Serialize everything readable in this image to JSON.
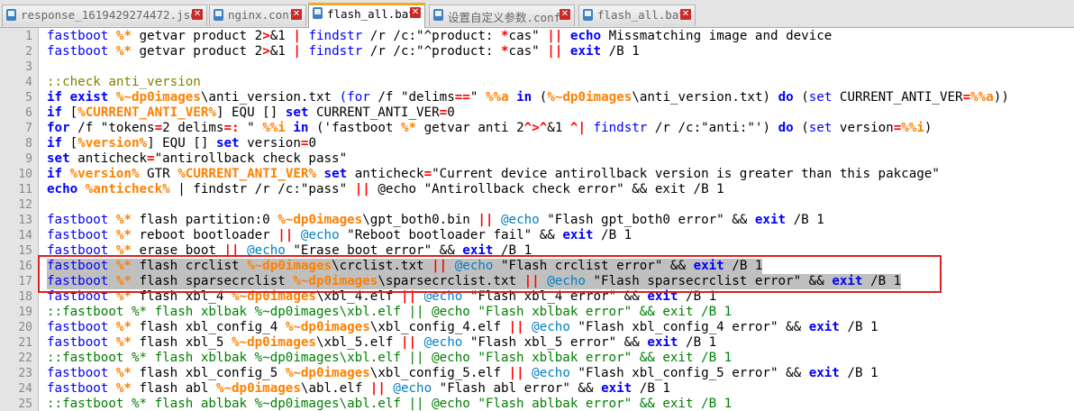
{
  "tabs": [
    {
      "label": "response_1619429274472.json",
      "active": false
    },
    {
      "label": "nginx.conf",
      "active": false
    },
    {
      "label": "flash_all.bat",
      "active": true
    },
    {
      "label": "设置自定义参数.conf",
      "active": false
    },
    {
      "label": "flash_all.bat",
      "active": false
    }
  ],
  "colors": {
    "keyword": "#0000ff",
    "variable": "#ff8000",
    "operator": "#ff0000",
    "comment": "#008000",
    "label": "#808000",
    "selection": "#c0c0c0",
    "highlight_box": "#e02020",
    "active_tab_accent": "#f5a623"
  },
  "editor": {
    "highlight_box_lines": [
      16,
      17
    ],
    "selected_lines": [
      16,
      17
    ],
    "lines": [
      {
        "n": "1",
        "tokens": [
          [
            "fastboot ",
            "ex"
          ],
          [
            "%*",
            "var"
          ],
          [
            " getvar product 2",
            "tx"
          ],
          [
            ">",
            "op"
          ],
          [
            "&1 ",
            "tx"
          ],
          [
            "|",
            "op"
          ],
          [
            " ",
            "tx"
          ],
          [
            "findstr",
            "ex"
          ],
          [
            " /r /c:\"^product: ",
            "tx"
          ],
          [
            "*",
            "op"
          ],
          [
            "cas\" ",
            "tx"
          ],
          [
            "||",
            "op"
          ],
          [
            " ",
            "tx"
          ],
          [
            "echo",
            "kw"
          ],
          [
            " Missmatching image and device",
            "tx"
          ]
        ]
      },
      {
        "n": "2",
        "tokens": [
          [
            "fastboot ",
            "ex"
          ],
          [
            "%*",
            "var"
          ],
          [
            " getvar product 2",
            "tx"
          ],
          [
            ">",
            "op"
          ],
          [
            "&1 ",
            "tx"
          ],
          [
            "|",
            "op"
          ],
          [
            " ",
            "tx"
          ],
          [
            "findstr",
            "ex"
          ],
          [
            " /r /c:\"^product: ",
            "tx"
          ],
          [
            "*",
            "op"
          ],
          [
            "cas\" ",
            "tx"
          ],
          [
            "||",
            "op"
          ],
          [
            " ",
            "tx"
          ],
          [
            "exit",
            "kw"
          ],
          [
            " /B 1",
            "tx"
          ]
        ]
      },
      {
        "n": "3",
        "tokens": []
      },
      {
        "n": "4",
        "tokens": [
          [
            "::check anti_version",
            "lb"
          ]
        ]
      },
      {
        "n": "5",
        "tokens": [
          [
            "if",
            "kw"
          ],
          [
            " ",
            "tx"
          ],
          [
            "exist",
            "kw"
          ],
          [
            " ",
            "tx"
          ],
          [
            "%~dp0images",
            "var"
          ],
          [
            "\\anti_version.txt ",
            "tx"
          ],
          [
            "(",
            "ex"
          ],
          [
            "for",
            "ex"
          ],
          [
            " /f \"delims",
            "tx"
          ],
          [
            "==",
            "op"
          ],
          [
            "\" ",
            "tx"
          ],
          [
            "%%a",
            "var"
          ],
          [
            " ",
            "tx"
          ],
          [
            "in",
            "kw"
          ],
          [
            " (",
            "tx"
          ],
          [
            "%~dp0images",
            "var"
          ],
          [
            "\\anti_version.txt) ",
            "tx"
          ],
          [
            "do",
            "kw"
          ],
          [
            " (",
            "tx"
          ],
          [
            "set",
            "ex"
          ],
          [
            " CURRENT_ANTI_VER",
            "tx"
          ],
          [
            "=",
            "op"
          ],
          [
            "%%a",
            "var"
          ],
          [
            "))",
            "tx"
          ]
        ]
      },
      {
        "n": "6",
        "tokens": [
          [
            "if",
            "kw"
          ],
          [
            " [",
            "tx"
          ],
          [
            "%CURRENT_ANTI_VER%",
            "var"
          ],
          [
            "] EQU [] ",
            "tx"
          ],
          [
            "set",
            "kw"
          ],
          [
            " CURRENT_ANTI_VER",
            "tx"
          ],
          [
            "=",
            "op"
          ],
          [
            "0",
            "tx"
          ]
        ]
      },
      {
        "n": "7",
        "tokens": [
          [
            "for",
            "kw"
          ],
          [
            " /f \"tokens",
            "tx"
          ],
          [
            "=",
            "op"
          ],
          [
            "2 delims",
            "tx"
          ],
          [
            "=: ",
            "op"
          ],
          [
            "\" ",
            "tx"
          ],
          [
            "%%i",
            "var"
          ],
          [
            " ",
            "tx"
          ],
          [
            "in",
            "kw"
          ],
          [
            " ('fastboot ",
            "tx"
          ],
          [
            "%*",
            "var"
          ],
          [
            " getvar anti 2",
            "tx"
          ],
          [
            "^>^",
            "op"
          ],
          [
            "&1 ",
            "tx"
          ],
          [
            "^|",
            "op"
          ],
          [
            " ",
            "tx"
          ],
          [
            "findstr",
            "ex"
          ],
          [
            " /r /c:\"anti:\"') ",
            "tx"
          ],
          [
            "do",
            "kw"
          ],
          [
            " (",
            "tx"
          ],
          [
            "set",
            "ex"
          ],
          [
            " version",
            "tx"
          ],
          [
            "=",
            "op"
          ],
          [
            "%%i",
            "var"
          ],
          [
            ")",
            "tx"
          ]
        ]
      },
      {
        "n": "8",
        "tokens": [
          [
            "if",
            "kw"
          ],
          [
            " [",
            "tx"
          ],
          [
            "%version%",
            "var"
          ],
          [
            "] EQU [] ",
            "tx"
          ],
          [
            "set",
            "kw"
          ],
          [
            " version",
            "tx"
          ],
          [
            "=",
            "op"
          ],
          [
            "0",
            "tx"
          ]
        ]
      },
      {
        "n": "9",
        "tokens": [
          [
            "set",
            "kw"
          ],
          [
            " anticheck",
            "tx"
          ],
          [
            "=",
            "op"
          ],
          [
            "\"antirollback check pass\"",
            "tx"
          ]
        ]
      },
      {
        "n": "10",
        "tokens": [
          [
            "if",
            "kw"
          ],
          [
            " ",
            "tx"
          ],
          [
            "%version%",
            "var"
          ],
          [
            " GTR ",
            "tx"
          ],
          [
            "%CURRENT_ANTI_VER%",
            "var"
          ],
          [
            " ",
            "tx"
          ],
          [
            "set",
            "kw"
          ],
          [
            " anticheck",
            "tx"
          ],
          [
            "=",
            "op"
          ],
          [
            "\"Current device antirollback version is greater than this pakcage\"",
            "tx"
          ]
        ]
      },
      {
        "n": "11",
        "tokens": [
          [
            "echo",
            "kw"
          ],
          [
            " ",
            "tx"
          ],
          [
            "%anticheck%",
            "var"
          ],
          [
            " | findstr /r /c:\"pass\" ",
            "tx"
          ],
          [
            "||",
            "op"
          ],
          [
            " @echo \"Antirollback check error\" && exit /B 1",
            "tx"
          ]
        ]
      },
      {
        "n": "12",
        "tokens": []
      },
      {
        "n": "13",
        "tokens": [
          [
            "fastboot ",
            "ex"
          ],
          [
            "%*",
            "var"
          ],
          [
            " flash partition:0 ",
            "tx"
          ],
          [
            "%~dp0images",
            "var"
          ],
          [
            "\\gpt_both0.bin ",
            "tx"
          ],
          [
            "||",
            "op"
          ],
          [
            " ",
            "tx"
          ],
          [
            "@echo",
            "at"
          ],
          [
            " \"Flash gpt_both0 error\" && ",
            "tx"
          ],
          [
            "exit",
            "kw"
          ],
          [
            " /B 1",
            "tx"
          ]
        ]
      },
      {
        "n": "14",
        "tokens": [
          [
            "fastboot ",
            "ex"
          ],
          [
            "%*",
            "var"
          ],
          [
            " reboot bootloader ",
            "tx"
          ],
          [
            "||",
            "op"
          ],
          [
            " ",
            "tx"
          ],
          [
            "@echo",
            "at"
          ],
          [
            " \"Reboot bootloader fail\" && ",
            "tx"
          ],
          [
            "exit",
            "kw"
          ],
          [
            " /B 1",
            "tx"
          ]
        ]
      },
      {
        "n": "15",
        "tokens": [
          [
            "fastboot ",
            "ex"
          ],
          [
            "%*",
            "var"
          ],
          [
            " erase boot ",
            "tx"
          ],
          [
            "||",
            "op"
          ],
          [
            " ",
            "tx"
          ],
          [
            "@echo",
            "at"
          ],
          [
            " \"Erase boot error\" && ",
            "tx"
          ],
          [
            "exit",
            "kw"
          ],
          [
            " /B 1",
            "tx"
          ]
        ]
      },
      {
        "n": "16",
        "tokens": [
          [
            "fastboot ",
            "ex"
          ],
          [
            "%*",
            "var"
          ],
          [
            " flash crclist ",
            "tx"
          ],
          [
            "%~dp0images",
            "var"
          ],
          [
            "\\crclist.txt ",
            "tx"
          ],
          [
            "||",
            "op"
          ],
          [
            " ",
            "tx"
          ],
          [
            "@echo",
            "at"
          ],
          [
            " \"Flash crclist error\" && ",
            "tx"
          ],
          [
            "exit",
            "kw"
          ],
          [
            " /B 1",
            "tx"
          ]
        ]
      },
      {
        "n": "17",
        "tokens": [
          [
            "fastboot ",
            "ex"
          ],
          [
            "%*",
            "var"
          ],
          [
            " flash sparsecrclist ",
            "tx"
          ],
          [
            "%~dp0images",
            "var"
          ],
          [
            "\\sparsecrclist.txt ",
            "tx"
          ],
          [
            "||",
            "op"
          ],
          [
            " ",
            "tx"
          ],
          [
            "@echo",
            "at"
          ],
          [
            " \"Flash sparsecrclist error\" && ",
            "tx"
          ],
          [
            "exit",
            "kw"
          ],
          [
            " /B 1",
            "tx"
          ]
        ]
      },
      {
        "n": "18",
        "tokens": [
          [
            "fastboot ",
            "ex"
          ],
          [
            "%*",
            "var"
          ],
          [
            " flash xbl_4 ",
            "tx"
          ],
          [
            "%~dp0images",
            "var"
          ],
          [
            "\\xbl_4.elf ",
            "tx"
          ],
          [
            "||",
            "op"
          ],
          [
            " ",
            "tx"
          ],
          [
            "@echo",
            "at"
          ],
          [
            " \"Flash xbl_4 error\" && ",
            "tx"
          ],
          [
            "exit",
            "kw"
          ],
          [
            " /B 1",
            "tx"
          ]
        ]
      },
      {
        "n": "19",
        "tokens": [
          [
            "::fastboot %* flash xblbak %~dp0images\\xbl.elf || @echo \"Flash xblbak error\" && exit /B 1",
            "cm"
          ]
        ]
      },
      {
        "n": "20",
        "tokens": [
          [
            "fastboot ",
            "ex"
          ],
          [
            "%*",
            "var"
          ],
          [
            " flash xbl_config_4 ",
            "tx"
          ],
          [
            "%~dp0images",
            "var"
          ],
          [
            "\\xbl_config_4.elf ",
            "tx"
          ],
          [
            "||",
            "op"
          ],
          [
            " ",
            "tx"
          ],
          [
            "@echo",
            "at"
          ],
          [
            " \"Flash xbl_config_4 error\" && ",
            "tx"
          ],
          [
            "exit",
            "kw"
          ],
          [
            " /B 1",
            "tx"
          ]
        ]
      },
      {
        "n": "21",
        "tokens": [
          [
            "fastboot ",
            "ex"
          ],
          [
            "%*",
            "var"
          ],
          [
            " flash xbl_5 ",
            "tx"
          ],
          [
            "%~dp0images",
            "var"
          ],
          [
            "\\xbl_5.elf ",
            "tx"
          ],
          [
            "||",
            "op"
          ],
          [
            " ",
            "tx"
          ],
          [
            "@echo",
            "at"
          ],
          [
            " \"Flash xbl_5 error\" && ",
            "tx"
          ],
          [
            "exit",
            "kw"
          ],
          [
            " /B 1",
            "tx"
          ]
        ]
      },
      {
        "n": "22",
        "tokens": [
          [
            "::fastboot %* flash xblbak %~dp0images\\xbl.elf || @echo \"Flash xblbak error\" && exit /B 1",
            "cm"
          ]
        ]
      },
      {
        "n": "23",
        "tokens": [
          [
            "fastboot ",
            "ex"
          ],
          [
            "%*",
            "var"
          ],
          [
            " flash xbl_config_5 ",
            "tx"
          ],
          [
            "%~dp0images",
            "var"
          ],
          [
            "\\xbl_config_5.elf ",
            "tx"
          ],
          [
            "||",
            "op"
          ],
          [
            " ",
            "tx"
          ],
          [
            "@echo",
            "at"
          ],
          [
            " \"Flash xbl_config_5 error\" && ",
            "tx"
          ],
          [
            "exit",
            "kw"
          ],
          [
            " /B 1",
            "tx"
          ]
        ]
      },
      {
        "n": "24",
        "tokens": [
          [
            "fastboot ",
            "ex"
          ],
          [
            "%*",
            "var"
          ],
          [
            " flash abl ",
            "tx"
          ],
          [
            "%~dp0images",
            "var"
          ],
          [
            "\\abl.elf ",
            "tx"
          ],
          [
            "||",
            "op"
          ],
          [
            " ",
            "tx"
          ],
          [
            "@echo",
            "at"
          ],
          [
            " \"Flash abl error\" && ",
            "tx"
          ],
          [
            "exit",
            "kw"
          ],
          [
            " /B 1",
            "tx"
          ]
        ]
      },
      {
        "n": "25",
        "tokens": [
          [
            "::fastboot %* flash ablbak %~dp0images\\abl.elf || @echo \"Flash ablbak error\" && exit /B 1",
            "cm"
          ]
        ]
      }
    ]
  }
}
